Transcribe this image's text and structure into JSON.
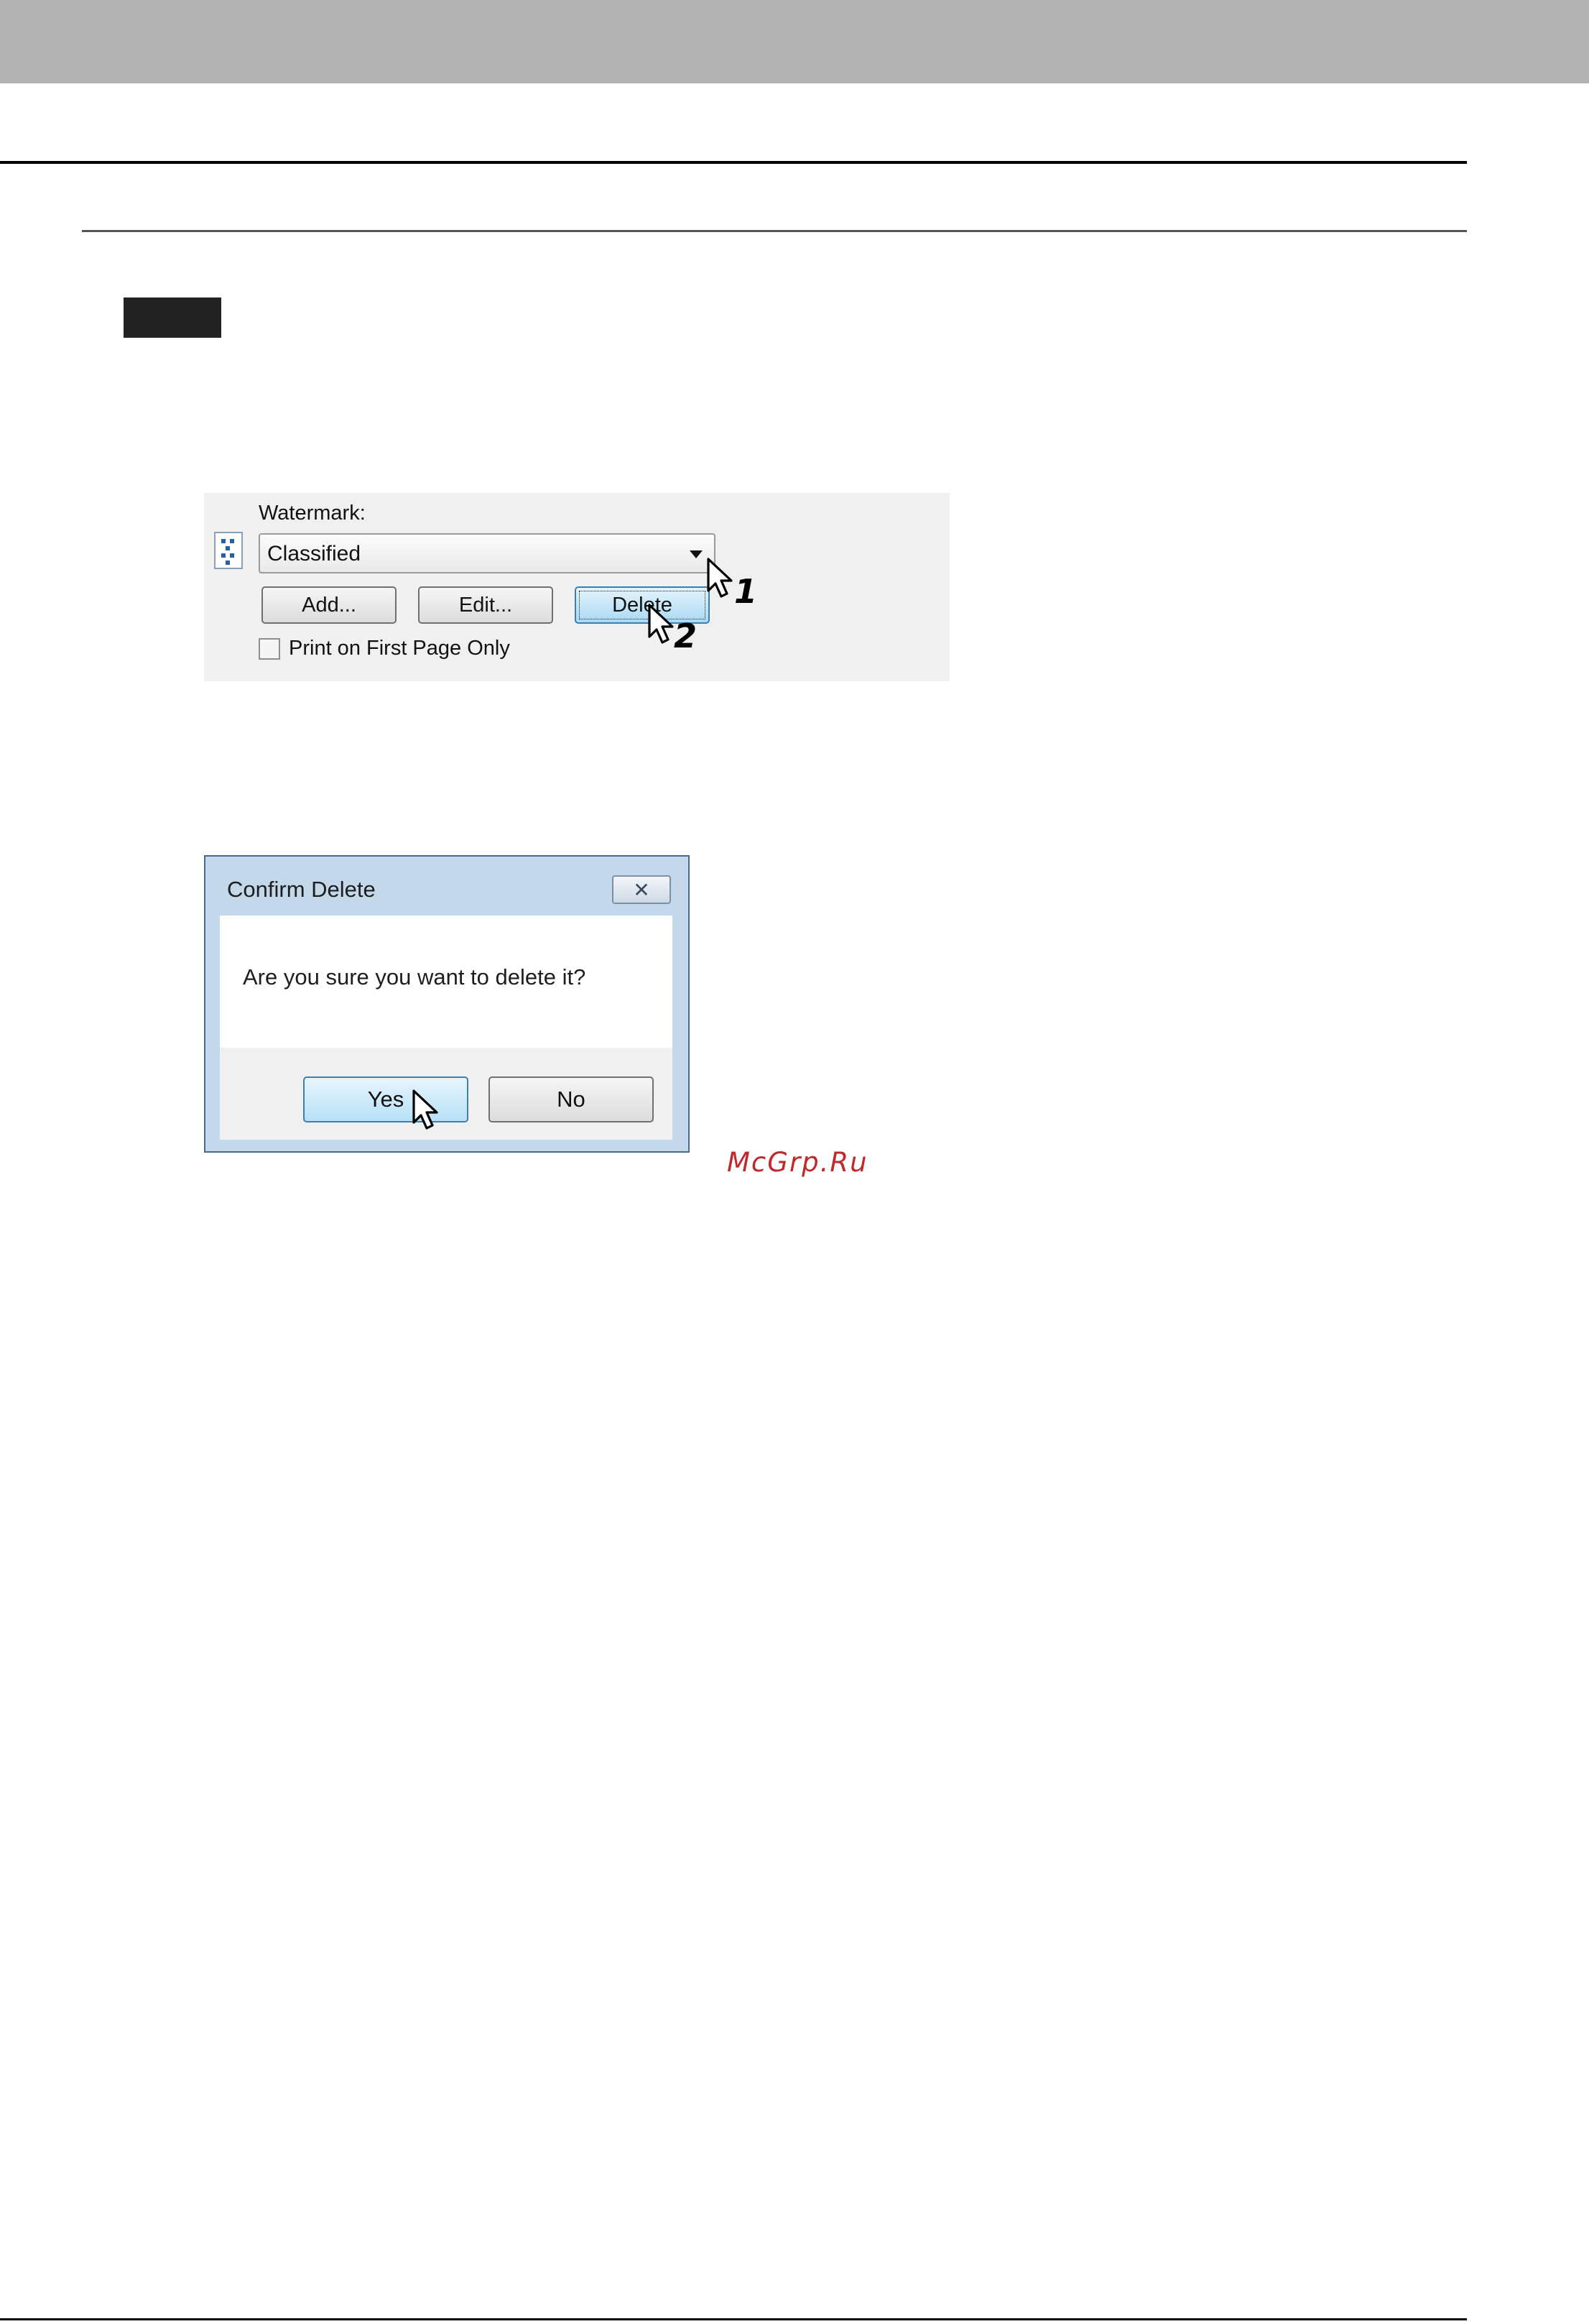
{
  "watermark_panel": {
    "label": "Watermark:",
    "selected_value": "Classified",
    "buttons": {
      "add": "Add...",
      "edit": "Edit...",
      "delete": "Delete"
    },
    "checkbox_label": "Print on First Page Only",
    "checkbox_checked": false,
    "callouts": [
      "1",
      "2"
    ]
  },
  "confirm_dialog": {
    "title": "Confirm Delete",
    "close_glyph": "✕",
    "message": "Are you sure you want to delete it?",
    "yes_label": "Yes",
    "no_label": "No"
  },
  "watermark_text": "McGrp.Ru",
  "colors": {
    "header_band": "#b2b2b2",
    "dialog_frame": "#c4d8ec",
    "button_focus": "#3c7fb1",
    "watermark_text": "#c0292b"
  }
}
